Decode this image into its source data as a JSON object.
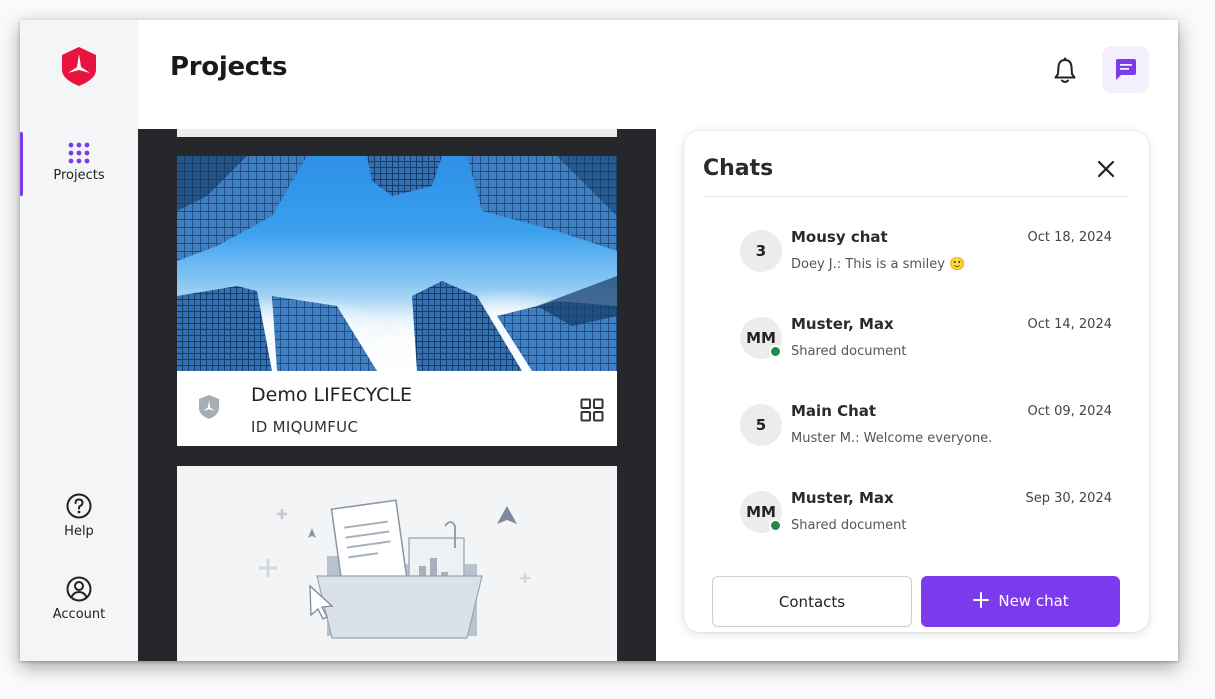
{
  "header": {
    "title": "Projects"
  },
  "sidebar": {
    "items": [
      {
        "label": "Projects",
        "icon": "grid-dots-icon",
        "active": true
      },
      {
        "label": "Help",
        "icon": "help-circle-icon"
      },
      {
        "label": "Account",
        "icon": "user-circle-icon"
      }
    ]
  },
  "project": {
    "title": "Demo LIFECYCLE",
    "id_text": "ID MIQUMFUC"
  },
  "chats": {
    "title": "Chats",
    "items": [
      {
        "avatar": "3",
        "name": "Mousy chat",
        "date": "Oct 18, 2024",
        "message": "Doey J.: This is a smiley 🙂",
        "online": false
      },
      {
        "avatar": "MM",
        "name": "Muster, Max",
        "date": "Oct 14, 2024",
        "message": "Shared document",
        "online": true
      },
      {
        "avatar": "5",
        "name": "Main Chat",
        "date": "Oct 09, 2024",
        "message": "Muster M.: Welcome everyone.",
        "online": false
      },
      {
        "avatar": "MM",
        "name": "Muster, Max",
        "date": "Sep 30, 2024",
        "message": "Shared document",
        "online": true
      }
    ],
    "contacts_label": "Contacts",
    "new_chat_label": "New chat"
  },
  "colors": {
    "accent": "#7c3aed",
    "brand": "#e8133f",
    "online": "#1e8a4e",
    "project_bg": "#25272b"
  }
}
